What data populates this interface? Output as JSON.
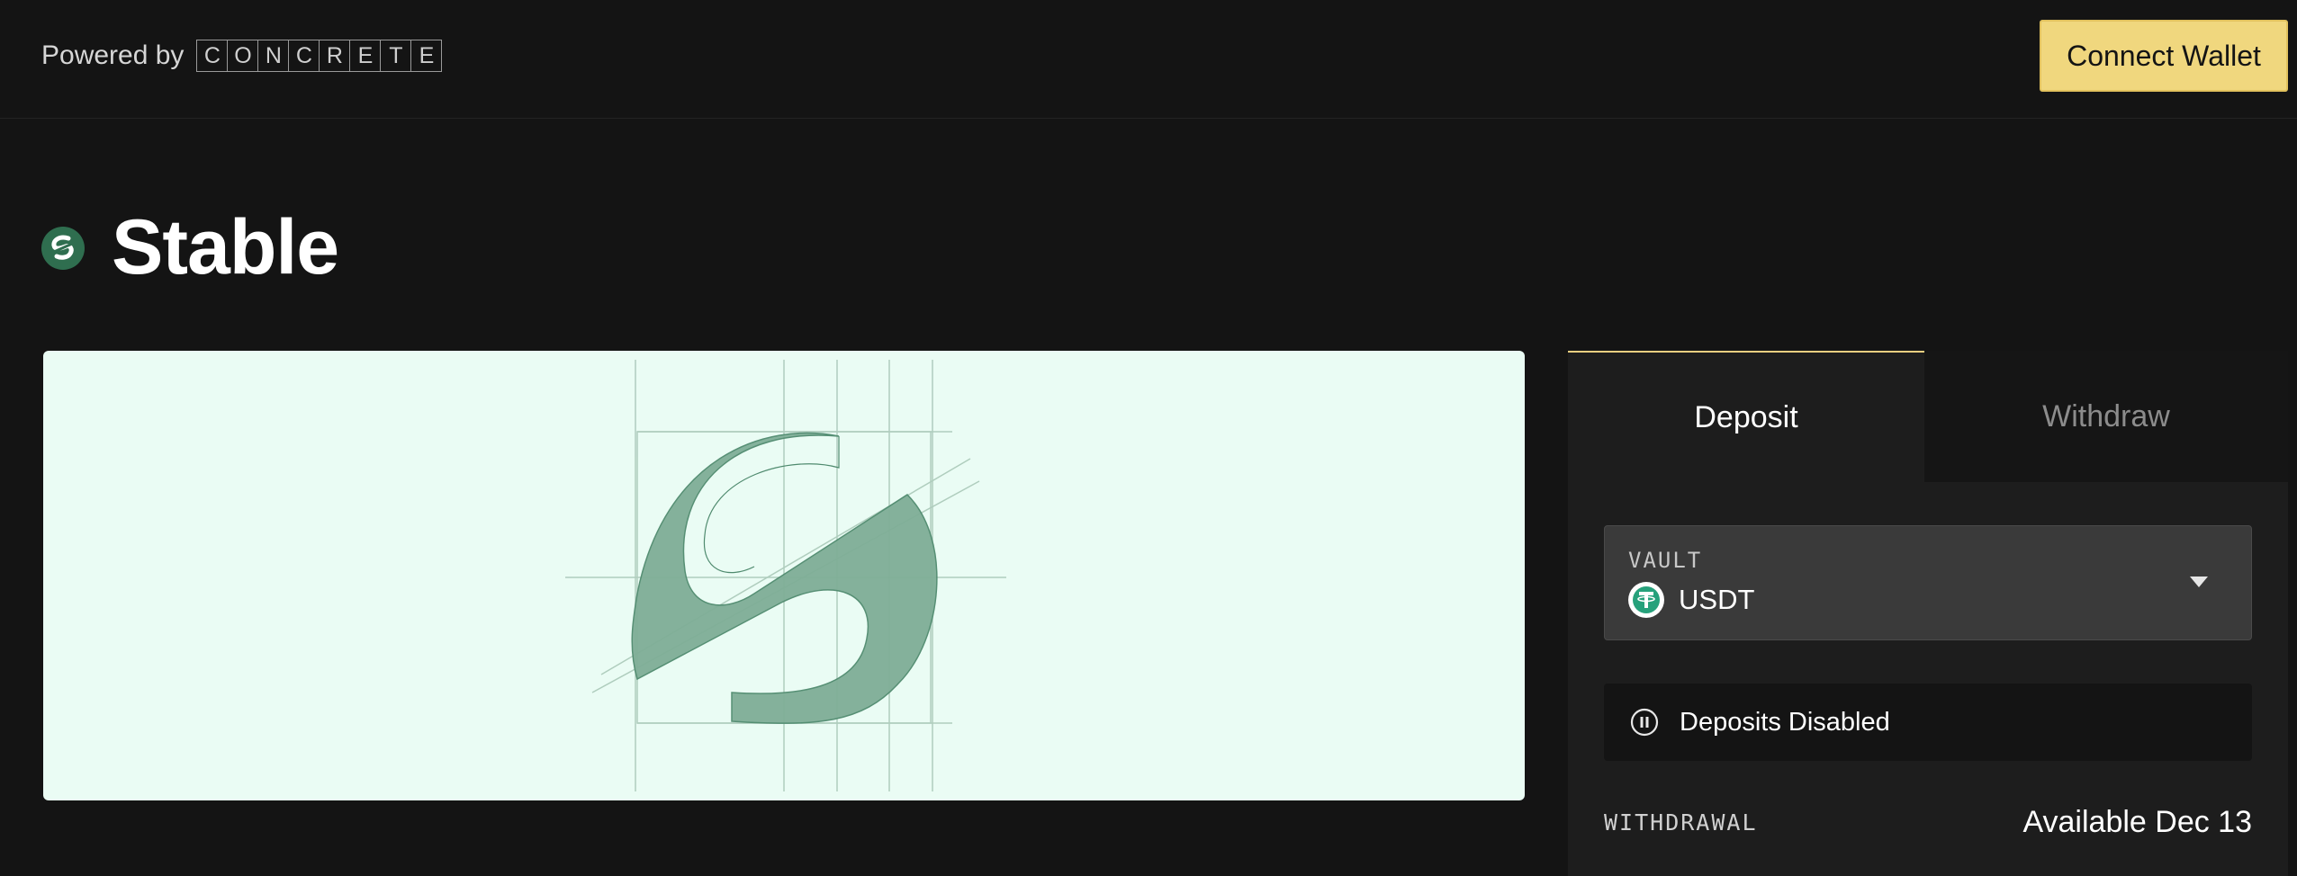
{
  "header": {
    "powered_by": "Powered by",
    "brand_letters": [
      "C",
      "O",
      "N",
      "C",
      "R",
      "E",
      "T",
      "E"
    ],
    "connect_wallet": "Connect Wallet"
  },
  "page": {
    "title": "Stable",
    "logo_icon": "stable-logo-icon"
  },
  "panel": {
    "tabs": [
      {
        "label": "Deposit",
        "active": true
      },
      {
        "label": "Withdraw",
        "active": false
      }
    ],
    "vault": {
      "label": "VAULT",
      "value": "USDT",
      "icon": "usdt-icon"
    },
    "status": {
      "icon": "pause-icon",
      "text": "Deposits Disabled"
    },
    "withdrawal": {
      "label": "WITHDRAWAL",
      "value": "Available Dec 13"
    }
  },
  "colors": {
    "background": "#141414",
    "accent": "#f0d77e",
    "hero_bg": "#eafcf4",
    "brand_green": "#2f6e4f"
  }
}
